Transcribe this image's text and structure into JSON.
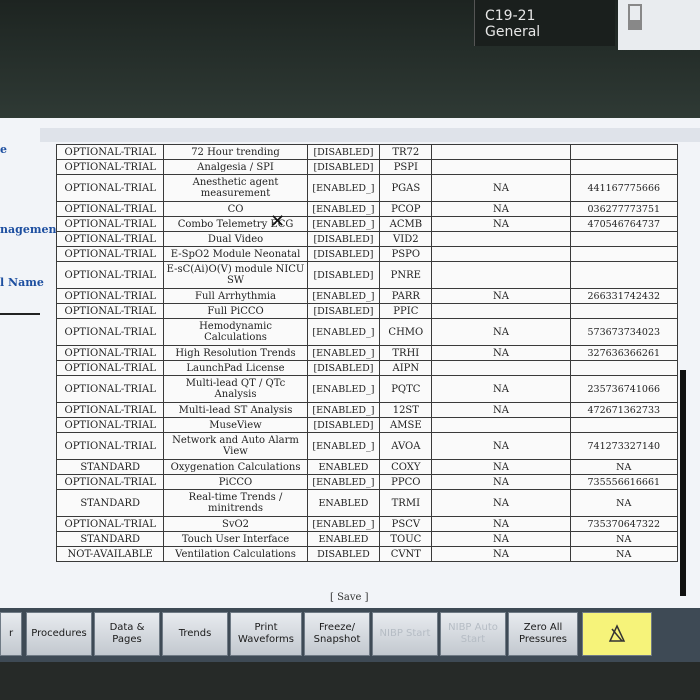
{
  "header": {
    "bed": "C19-21",
    "profile": "General"
  },
  "sidebar": {
    "item1": "e",
    "item2": "nagement",
    "item3": "l Name"
  },
  "options": [
    {
      "status": "OPTIONAL-TRIAL",
      "name": "72 Hour trending",
      "enabled": "[DISABLED]",
      "code": "TR72",
      "na": "",
      "number": ""
    },
    {
      "status": "OPTIONAL-TRIAL",
      "name": "Analgesia / SPI",
      "enabled": "[DISABLED]",
      "code": "PSPI",
      "na": "",
      "number": ""
    },
    {
      "status": "OPTIONAL-TRIAL",
      "name": "Anesthetic agent measurement",
      "enabled": "[ENABLED_]",
      "code": "PGAS",
      "na": "NA",
      "number": "441167775666"
    },
    {
      "status": "OPTIONAL-TRIAL",
      "name": "CO",
      "enabled": "[ENABLED_]",
      "code": "PCOP",
      "na": "NA",
      "number": "036277773751"
    },
    {
      "status": "OPTIONAL-TRIAL",
      "name": "Combo Telemetry ECG",
      "enabled": "[ENABLED_]",
      "code": "ACMB",
      "na": "NA",
      "number": "470546764737"
    },
    {
      "status": "OPTIONAL-TRIAL",
      "name": "Dual Video",
      "enabled": "[DISABLED]",
      "code": "VID2",
      "na": "",
      "number": ""
    },
    {
      "status": "OPTIONAL-TRIAL",
      "name": "E-SpO2 Module Neonatal",
      "enabled": "[DISABLED]",
      "code": "PSPO",
      "na": "",
      "number": ""
    },
    {
      "status": "OPTIONAL-TRIAL",
      "name": "E-sC(Ai)O(V) module NICU SW",
      "enabled": "[DISABLED]",
      "code": "PNRE",
      "na": "",
      "number": ""
    },
    {
      "status": "OPTIONAL-TRIAL",
      "name": "Full Arrhythmia",
      "enabled": "[ENABLED_]",
      "code": "PARR",
      "na": "NA",
      "number": "266331742432"
    },
    {
      "status": "OPTIONAL-TRIAL",
      "name": "Full PiCCO",
      "enabled": "[DISABLED]",
      "code": "PPIC",
      "na": "",
      "number": ""
    },
    {
      "status": "OPTIONAL-TRIAL",
      "name": "Hemodynamic Calculations",
      "enabled": "[ENABLED_]",
      "code": "CHMO",
      "na": "NA",
      "number": "573673734023"
    },
    {
      "status": "OPTIONAL-TRIAL",
      "name": "High Resolution Trends",
      "enabled": "[ENABLED_]",
      "code": "TRHI",
      "na": "NA",
      "number": "327636366261"
    },
    {
      "status": "OPTIONAL-TRIAL",
      "name": "LaunchPad License",
      "enabled": "[DISABLED]",
      "code": "AIPN",
      "na": "",
      "number": ""
    },
    {
      "status": "OPTIONAL-TRIAL",
      "name": "Multi-lead QT / QTc Analysis",
      "enabled": "[ENABLED_]",
      "code": "PQTC",
      "na": "NA",
      "number": "235736741066"
    },
    {
      "status": "OPTIONAL-TRIAL",
      "name": "Multi-lead ST Analysis",
      "enabled": "[ENABLED_]",
      "code": "12ST",
      "na": "NA",
      "number": "472671362733"
    },
    {
      "status": "OPTIONAL-TRIAL",
      "name": "MuseView",
      "enabled": "[DISABLED]",
      "code": "AMSE",
      "na": "",
      "number": ""
    },
    {
      "status": "OPTIONAL-TRIAL",
      "name": "Network and Auto Alarm View",
      "enabled": "[ENABLED_]",
      "code": "AVOA",
      "na": "NA",
      "number": "741273327140"
    },
    {
      "status": "STANDARD",
      "name": "Oxygenation Calculations",
      "enabled": "ENABLED",
      "code": "COXY",
      "na": "NA",
      "number": "NA"
    },
    {
      "status": "OPTIONAL-TRIAL",
      "name": "PiCCO",
      "enabled": "[ENABLED_]",
      "code": "PPCO",
      "na": "NA",
      "number": "735556616661"
    },
    {
      "status": "STANDARD",
      "name": "Real-time Trends / minitrends",
      "enabled": "ENABLED",
      "code": "TRMI",
      "na": "NA",
      "number": "NA"
    },
    {
      "status": "OPTIONAL-TRIAL",
      "name": "SvO2",
      "enabled": "[ENABLED_]",
      "code": "PSCV",
      "na": "NA",
      "number": "735370647322"
    },
    {
      "status": "STANDARD",
      "name": "Touch User Interface",
      "enabled": "ENABLED",
      "code": "TOUC",
      "na": "NA",
      "number": "NA"
    },
    {
      "status": "NOT-AVAILABLE",
      "name": "Ventilation Calculations",
      "enabled": "DISABLED",
      "code": "CVNT",
      "na": "NA",
      "number": "NA"
    }
  ],
  "save_label": "[ Save ]",
  "buttons": {
    "b0": "r",
    "procedures": "Procedures",
    "data_pages": "Data & Pages",
    "trends": "Trends",
    "print": "Print Waveforms",
    "freeze": "Freeze/ Snapshot",
    "nibp": "NIBP Start",
    "nibp_auto": "NIBP Auto Start",
    "zero": "Zero All Pressures",
    "alarm_icon": "alarm-silence-icon"
  },
  "colors": {
    "enabled_alarm": "#f6f37a",
    "sidebar_text": "#1e4fa0"
  }
}
